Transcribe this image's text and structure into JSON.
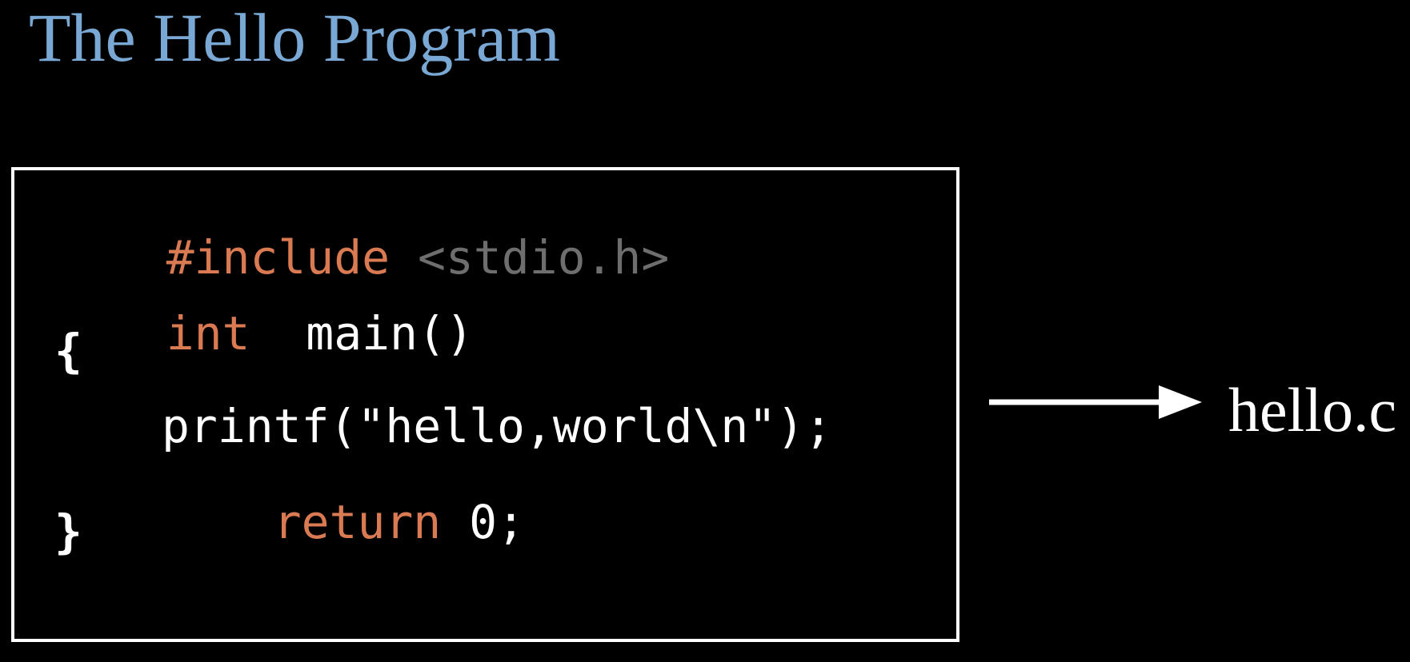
{
  "title": "The Hello Program",
  "code": {
    "line1": {
      "keyword": "#include",
      "header": "<stdio.h>"
    },
    "line2": {
      "keyword": "int",
      "text": "main()"
    },
    "line3": {
      "text": "{"
    },
    "line4": {
      "text": "printf(\"hello,world\\n\");"
    },
    "line5": {
      "keyword": "return",
      "text": "0;"
    },
    "line6": {
      "text": "}"
    }
  },
  "output_file": "hello.c",
  "colors": {
    "title": "#7aa8d4",
    "keyword": "#d97a52",
    "header": "#6e6e6e",
    "code_text": "#ffffff",
    "background": "#000000",
    "box_border": "#ffffff",
    "arrow": "#ffffff"
  },
  "icons": {
    "arrow": "right-arrow-icon"
  }
}
